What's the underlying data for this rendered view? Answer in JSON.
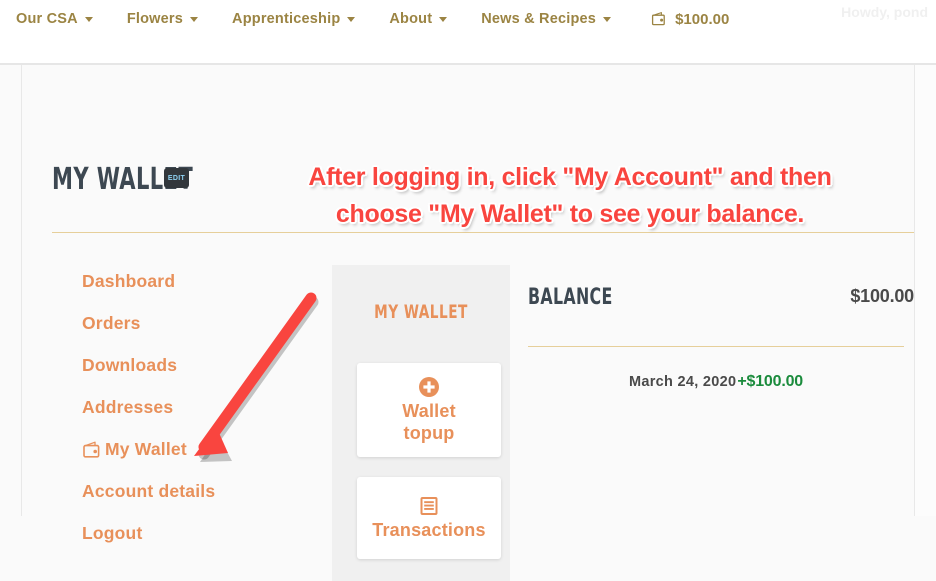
{
  "colors": {
    "nav_text": "#9b8443",
    "accent_orange": "#e8905a",
    "annotation_red": "#f9453f",
    "credit_green": "#1a8b3c",
    "heading_dark": "#3d4852",
    "divider_tan": "#e6cf9a",
    "panel_grey": "#f0f0f0",
    "page_bg": "#fafafa"
  },
  "topnav": {
    "items": [
      {
        "label": "Our CSA",
        "has_caret": true
      },
      {
        "label": "Flowers",
        "has_caret": true
      },
      {
        "label": "Apprenticeship",
        "has_caret": true
      },
      {
        "label": "About",
        "has_caret": true
      },
      {
        "label": "News & Recipes",
        "has_caret": true
      }
    ],
    "wallet": {
      "icon": "wallet-icon",
      "amount": "$100.00"
    },
    "greeting": "Howdy, pond"
  },
  "page": {
    "title": "My Wallet",
    "edit_badge": "EDIT"
  },
  "annotation": {
    "line1": "After logging in, click \"My Account\" and then",
    "line2": "choose \"My Wallet\" to see your balance.",
    "arrow": "red-arrow-pointing-to-my-wallet"
  },
  "sidebar": {
    "items": [
      {
        "label": "Dashboard",
        "icon": null
      },
      {
        "label": "Orders",
        "icon": null
      },
      {
        "label": "Downloads",
        "icon": null
      },
      {
        "label": "Addresses",
        "icon": null
      },
      {
        "label": "My Wallet",
        "icon": "wallet-icon"
      },
      {
        "label": "Account details",
        "icon": null
      },
      {
        "label": "Logout",
        "icon": null
      }
    ]
  },
  "wallet_panel": {
    "title": "My Wallet",
    "cards": [
      {
        "label_line1": "Wallet",
        "label_line2": "topup",
        "icon": "plus-circle-icon"
      },
      {
        "label_line1": "Transactions",
        "label_line2": "",
        "icon": "list-icon"
      }
    ]
  },
  "balance": {
    "title": "Balance",
    "amount": "$100.00",
    "transactions": [
      {
        "date": "March 24, 2020",
        "amount": "+$100.00",
        "type": "credit"
      }
    ]
  }
}
